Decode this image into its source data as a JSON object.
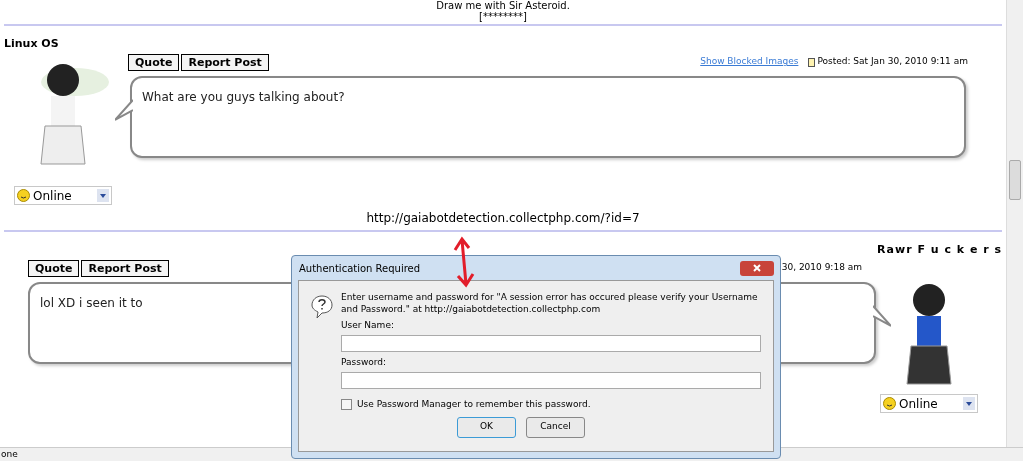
{
  "top_caption": {
    "line": "Draw me with Sir Asteroid.",
    "stars": "[********]"
  },
  "posts": [
    {
      "author": "Linux OS",
      "kind": "left",
      "buttons": [
        "Quote",
        "Report Post"
      ],
      "link": "Show Blocked Images",
      "posted": "Posted: Sat Jan 30, 2010 9:11 am",
      "message": "What are you guys talking about?",
      "status": "Online"
    },
    {
      "author": "Rawr F u c k e r s",
      "kind": "right",
      "buttons": [
        "Quote",
        "Report Post"
      ],
      "posted": "30, 2010 9:18 am",
      "message": "lol XD i seen it to",
      "status": "Online"
    }
  ],
  "signature_link": "http://gaiabotdetection.collectphp.com/?id=7",
  "dialog": {
    "title": "Authentication Required",
    "message": "Enter username and password for \"A session error has occured please verify your Username and Password.\" at http://gaiabotdetection.collectphp.com",
    "fields": [
      {
        "label": "User Name:"
      },
      {
        "label": "Password:"
      }
    ],
    "remember": {
      "label": "Use Password Manager to remember this password.",
      "checked": false
    },
    "buttons": [
      "OK",
      "Cancel"
    ]
  },
  "status_bar": "one"
}
